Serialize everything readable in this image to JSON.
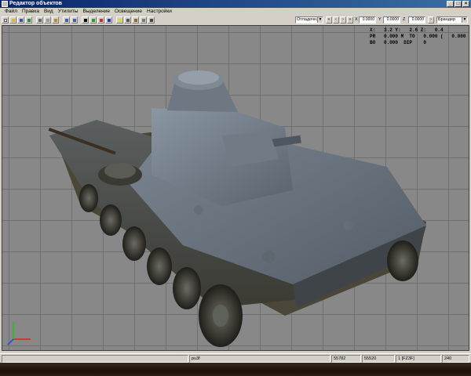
{
  "window": {
    "title": "Редактор объектов"
  },
  "menu": [
    "Файл",
    "Правка",
    "Вид",
    "Утилиты",
    "Выделение",
    "Освещение",
    "Настройки"
  ],
  "toolbar": {
    "mode_value": "Отладочн.",
    "coord_x": "0.0000",
    "coord_y": "0.0000",
    "coord_z": "0.0000",
    "label_x": "X",
    "label_y": "Y",
    "label_z": "Z",
    "right_combo": "Брандер"
  },
  "info": {
    "row1": "X:   3.2 Y:   2.6 Z:   0.4",
    "row2": "PR   0.000 M  TO   0.000 (   0.000 (",
    "row3": "BO   0.000  DIP    0"
  },
  "status": {
    "cell1": "",
    "cell2": "pu3f",
    "cell3": "55782",
    "cell4": "55520",
    "cell5": "1 [FZ3F]",
    "cell6": "240"
  },
  "colors": {
    "viewport_bg": "#888888",
    "grid": "#6f6f6f",
    "titlebar": "#0a246a"
  }
}
